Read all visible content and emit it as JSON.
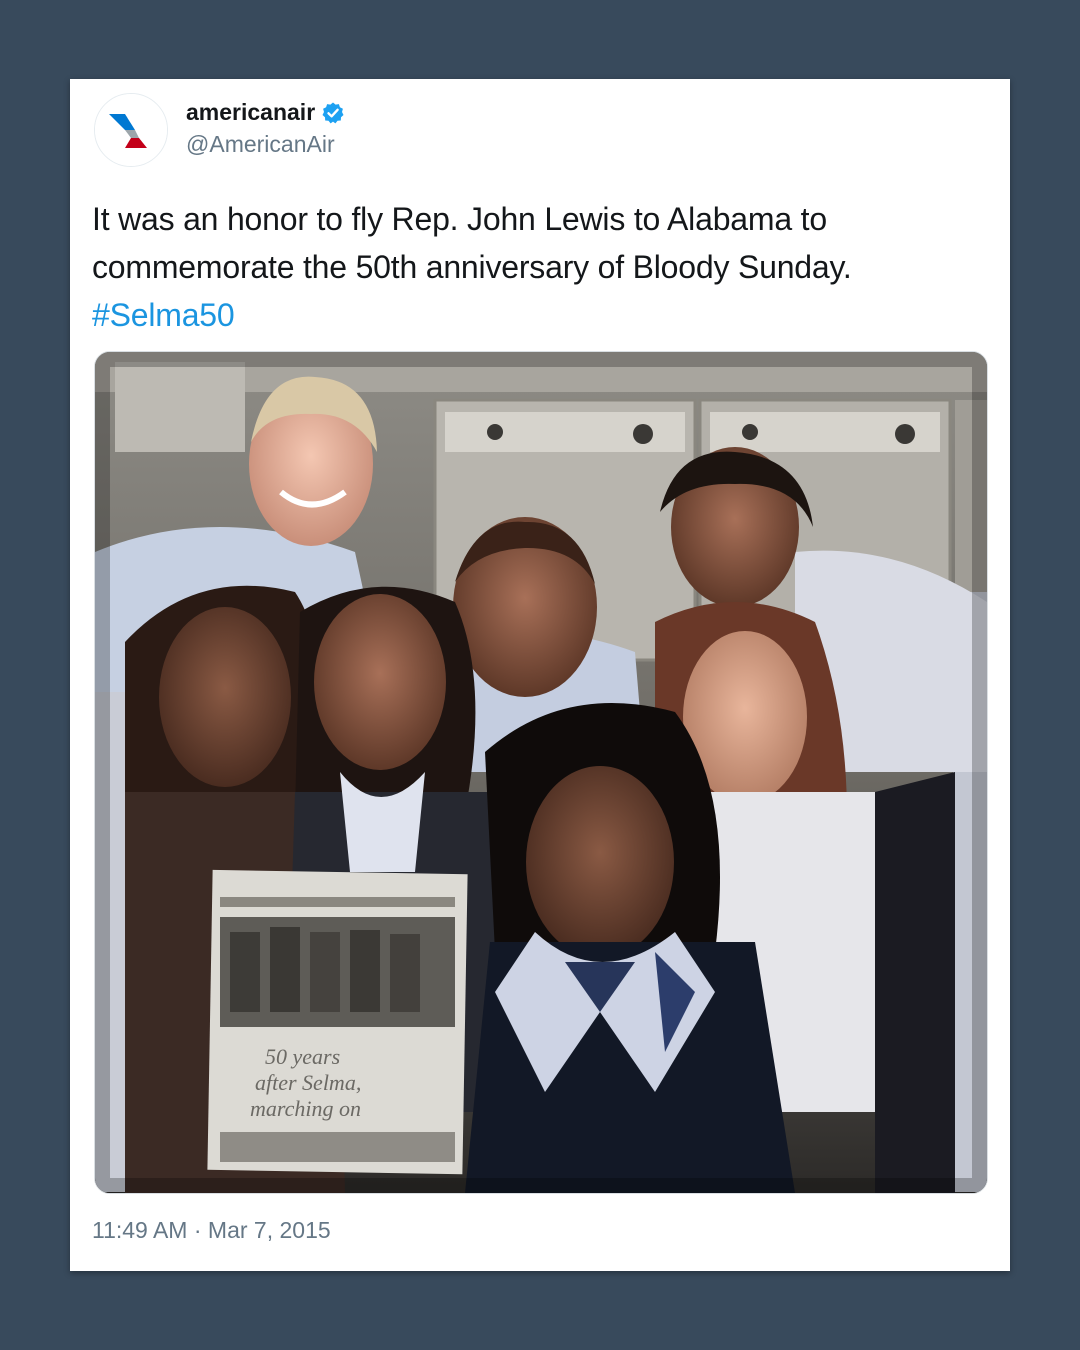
{
  "tweet": {
    "display_name": "americanair",
    "handle": "@AmericanAir",
    "text_line_1": "It was an honor to fly Rep. John Lewis to Alabama to",
    "text_line_2": "commemorate the 50th anniversary of Bloody Sunday.",
    "hashtag": "#Selma50",
    "timestamp": "11:49 AM · Mar 7, 2015"
  },
  "photo": {
    "newspaper_headline_1": "50 years",
    "newspaper_headline_2": "after Selma,",
    "newspaper_headline_3": "marching on"
  },
  "icons": {
    "avatar": "american-airlines-logo-icon",
    "badge": "verified-badge-icon"
  },
  "colors": {
    "background": "#384a5c",
    "card": "#ffffff",
    "text": "#14171a",
    "muted": "#657786",
    "link": "#1b95e0",
    "verified": "#1da1f2"
  }
}
